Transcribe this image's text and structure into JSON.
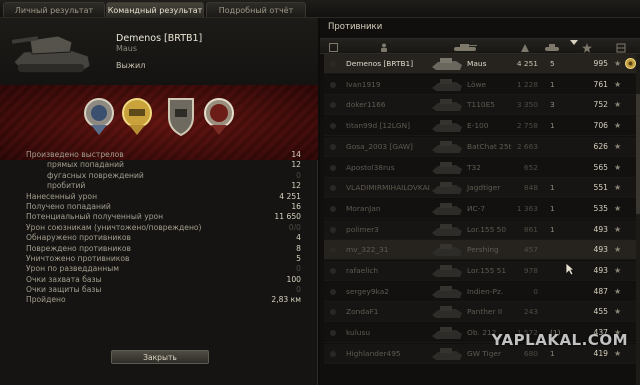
{
  "tabs": [
    {
      "label": "Личный результат"
    },
    {
      "label": "Командный результат"
    },
    {
      "label": "Подробный отчёт"
    }
  ],
  "player": {
    "name": "Demenos [BRTB1]",
    "vehicle": "Maus",
    "status": "Выжил"
  },
  "medals": [
    "medal-icon",
    "medal-icon",
    "medal-icon",
    "medal-icon"
  ],
  "stats": [
    {
      "label": "Произведено выстрелов",
      "value": "14",
      "sub": false,
      "dim": false
    },
    {
      "label": "прямых попаданий",
      "value": "12",
      "sub": true,
      "dim": false
    },
    {
      "label": "фугасных повреждений",
      "value": "0",
      "sub": true,
      "dim": true
    },
    {
      "label": "пробитий",
      "value": "12",
      "sub": true,
      "dim": false
    },
    {
      "label": "Нанесенный урон",
      "value": "4 251",
      "sub": false,
      "dim": false
    },
    {
      "label": "Получено попаданий",
      "value": "16",
      "sub": false,
      "dim": false
    },
    {
      "label": "Потенциальный полученный урон",
      "value": "11 650",
      "sub": false,
      "dim": false
    },
    {
      "label": "Урон союзникам (уничтожено/повреждено)",
      "value": "0/0",
      "sub": false,
      "dim": true
    },
    {
      "label": "Обнаружено противников",
      "value": "4",
      "sub": false,
      "dim": false
    },
    {
      "label": "Повреждено противников",
      "value": "8",
      "sub": false,
      "dim": false
    },
    {
      "label": "Уничтожено противников",
      "value": "5",
      "sub": false,
      "dim": false
    },
    {
      "label": "Урон по разведданным",
      "value": "0",
      "sub": false,
      "dim": true
    },
    {
      "label": "Очки захвата базы",
      "value": "100",
      "sub": false,
      "dim": false
    },
    {
      "label": "Очки защиты базы",
      "value": "0",
      "sub": false,
      "dim": true
    },
    {
      "label": "Пройдено",
      "value": "2,83 км",
      "sub": false,
      "dim": false
    }
  ],
  "close_label": "Закрыть",
  "enemies": {
    "title": "Противники",
    "columns": [
      "squad-icon",
      "player-icon",
      "tank-icon",
      "damage-icon",
      "kills-icon",
      "xp-sort-icon",
      "star-icon",
      "rank-icon"
    ],
    "rows": [
      {
        "name": "Demenos [BRTB1]",
        "tank": "Maus",
        "damage": "4 251",
        "kills": "5",
        "xp": "995",
        "self": true
      },
      {
        "name": "Ivan1919",
        "tank": "Löwe",
        "damage": "1 228",
        "kills": "1",
        "xp": "761",
        "self": false
      },
      {
        "name": "doker1166",
        "tank": "T110E5",
        "damage": "3 350",
        "kills": "3",
        "xp": "752",
        "self": false
      },
      {
        "name": "titan99d [12LGN]",
        "tank": "E-100",
        "damage": "2 758",
        "kills": "1",
        "xp": "706",
        "self": false
      },
      {
        "name": "Gosa_2003 [GAW]",
        "tank": "BatChat 25t",
        "damage": "2 663",
        "kills": "",
        "xp": "626",
        "self": false
      },
      {
        "name": "Apostol38rus",
        "tank": "T32",
        "damage": "652",
        "kills": "",
        "xp": "565",
        "self": false
      },
      {
        "name": "VLADIMIRMIHAILOVKAI",
        "tank": "Jagdtiger",
        "damage": "848",
        "kills": "1",
        "xp": "551",
        "self": false
      },
      {
        "name": "MoranJan",
        "tank": "ИС-7",
        "damage": "1 363",
        "kills": "1",
        "xp": "535",
        "self": false
      },
      {
        "name": "polimer3",
        "tank": "Lor.155 50",
        "damage": "861",
        "kills": "1",
        "xp": "493",
        "self": false
      },
      {
        "name": "mv_322_31",
        "tank": "Pershing",
        "damage": "457",
        "kills": "",
        "xp": "493",
        "self": false
      },
      {
        "name": "rafaelich",
        "tank": "Lor.155 51",
        "damage": "978",
        "kills": "",
        "xp": "493",
        "self": false
      },
      {
        "name": "sergey9ka2",
        "tank": "Indien-Pz.",
        "damage": "0",
        "kills": "",
        "xp": "487",
        "self": false
      },
      {
        "name": "ZondaF1",
        "tank": "Panther II",
        "damage": "243",
        "kills": "",
        "xp": "455",
        "self": false
      },
      {
        "name": "kulusu",
        "tank": "Ob. 212",
        "damage": "1 572",
        "kills": "(1)",
        "xp": "437",
        "self": false
      },
      {
        "name": "Highlander495",
        "tank": "GW Tiger",
        "damage": "680",
        "kills": "1",
        "xp": "419",
        "self": false
      }
    ]
  },
  "watermark": "YAPLAKAL.COM",
  "colors": {
    "accent_band": "#5a1110",
    "background": "#151412",
    "text": "#b4ad9c"
  }
}
